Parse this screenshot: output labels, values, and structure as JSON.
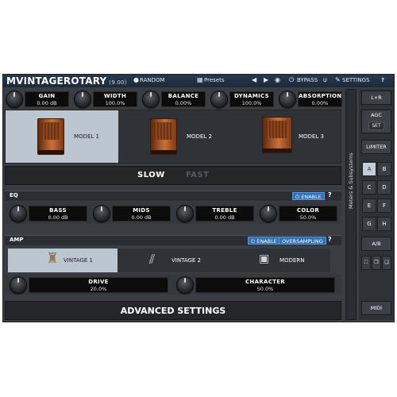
{
  "plugin": {
    "title": "MVINTAGEROTARY",
    "version": "(9.00)",
    "toolbar": {
      "random": "RANDOM",
      "presets": "Presets",
      "bypass": "BYPASS",
      "settings": "SETTINGS",
      "help": "?"
    },
    "main_knobs": [
      {
        "label": "GAIN",
        "value": "0.00 dB"
      },
      {
        "label": "WIDTH",
        "value": "100.0%"
      },
      {
        "label": "BALANCE",
        "value": "0.00%"
      },
      {
        "label": "DYNAMICS",
        "value": "100.0%"
      },
      {
        "label": "ABSORPTION",
        "value": "0.00%"
      }
    ],
    "models": [
      {
        "label": "MODEL 1",
        "selected": true
      },
      {
        "label": "MODEL 2",
        "selected": false
      },
      {
        "label": "MODEL 3",
        "selected": false
      }
    ],
    "speed": {
      "slow": "SLOW",
      "fast": "FAST",
      "active": "SLOW"
    },
    "eq": {
      "title": "EQ",
      "enable": "ENABLE",
      "help": "?",
      "knobs": [
        {
          "label": "BASS",
          "value": "0.00 dB"
        },
        {
          "label": "MIDS",
          "value": "0.00 dB"
        },
        {
          "label": "TREBLE",
          "value": "0.00 dB"
        },
        {
          "label": "COLOR",
          "value": "50.0%"
        }
      ]
    },
    "amp": {
      "title": "AMP",
      "enable": "ENABLE",
      "oversampling": "OVERSAMPLING",
      "help": "?",
      "types": [
        {
          "label": "VINTAGE 1",
          "selected": true
        },
        {
          "label": "VINTAGE 2",
          "selected": false
        },
        {
          "label": "MODERN",
          "selected": false
        }
      ],
      "knobs": [
        {
          "label": "DRIVE",
          "value": "20.0%"
        },
        {
          "label": "CHARACTER",
          "value": "50.0%"
        }
      ]
    },
    "advanced": "ADVANCED SETTINGS",
    "meters_label": "Meters & Subsystems",
    "right": {
      "lr": "L+R",
      "agc": "AGC",
      "set": "SET",
      "limiter": "LIMITER",
      "slots": [
        "A",
        "B",
        "C",
        "D",
        "E",
        "F",
        "G",
        "H"
      ],
      "ab": "A/B",
      "midi": "MIDI"
    },
    "colors": {
      "accent": "#2f6fb8",
      "selected": "#bcc6d0",
      "panel": "#3a3d42"
    }
  }
}
